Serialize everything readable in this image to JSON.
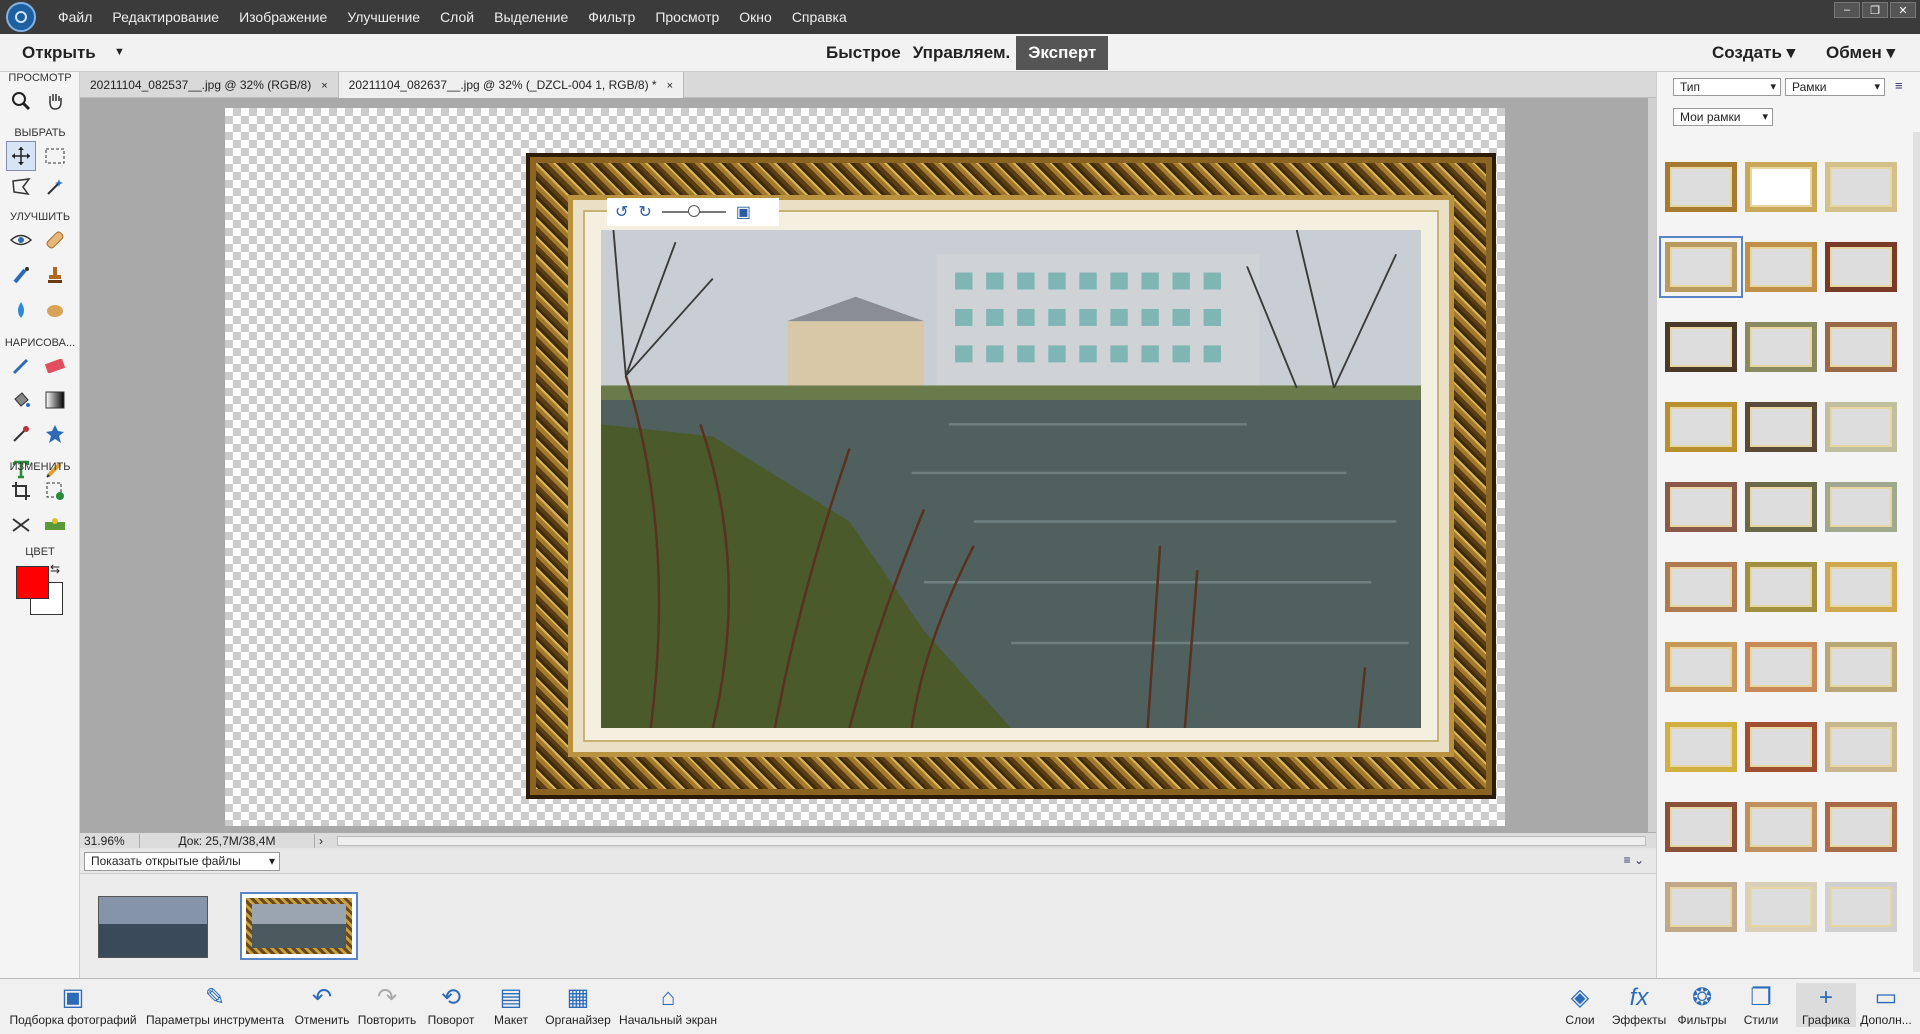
{
  "menubar": {
    "items": [
      "Файл",
      "Редактирование",
      "Изображение",
      "Улучшение",
      "Слой",
      "Выделение",
      "Фильтр",
      "Просмотр",
      "Окно",
      "Справка"
    ]
  },
  "modebar": {
    "open_label": "Открыть",
    "modes": [
      "Быстрое",
      "Управляем.",
      "Эксперт"
    ],
    "active_mode": "Эксперт",
    "create_label": "Создать",
    "share_label": "Обмен"
  },
  "toolbar": {
    "sections": {
      "view": "ПРОСМОТР",
      "select": "ВЫБРАТЬ",
      "enhance": "УЛУЧШИТЬ",
      "draw": "НАРИСОВА...",
      "modify": "ИЗМЕНИТЬ",
      "color": "ЦВЕТ"
    },
    "foreground_color": "#ff0000",
    "background_color": "#ffffff"
  },
  "tabs": [
    {
      "label": "20211104_082537__.jpg @ 32% (RGB/8)",
      "close": "×"
    },
    {
      "label": "20211104_082637__.jpg @ 32% (_DZCL-004 1, RGB/8) *",
      "close": "×"
    }
  ],
  "status": {
    "zoom": "31.96%",
    "doc": "Док: 25,7M/38,4M"
  },
  "photobin": {
    "select_label": "Показать открытые файлы"
  },
  "rpanel": {
    "type_label": "Тип",
    "category_label": "Рамки",
    "mine_label": "Мои рамки"
  },
  "bottombar": {
    "items": {
      "photos": "Подборка фотографий",
      "tool_options": "Параметры инструмента",
      "undo": "Отменить",
      "redo": "Повторить",
      "rotate": "Поворот",
      "layout": "Макет",
      "organizer": "Органайзер",
      "home": "Начальный экран",
      "layers": "Слои",
      "effects": "Эффекты",
      "filters": "Фильтры",
      "styles": "Стили",
      "graphics": "Графика",
      "more": "Дополн..."
    }
  }
}
